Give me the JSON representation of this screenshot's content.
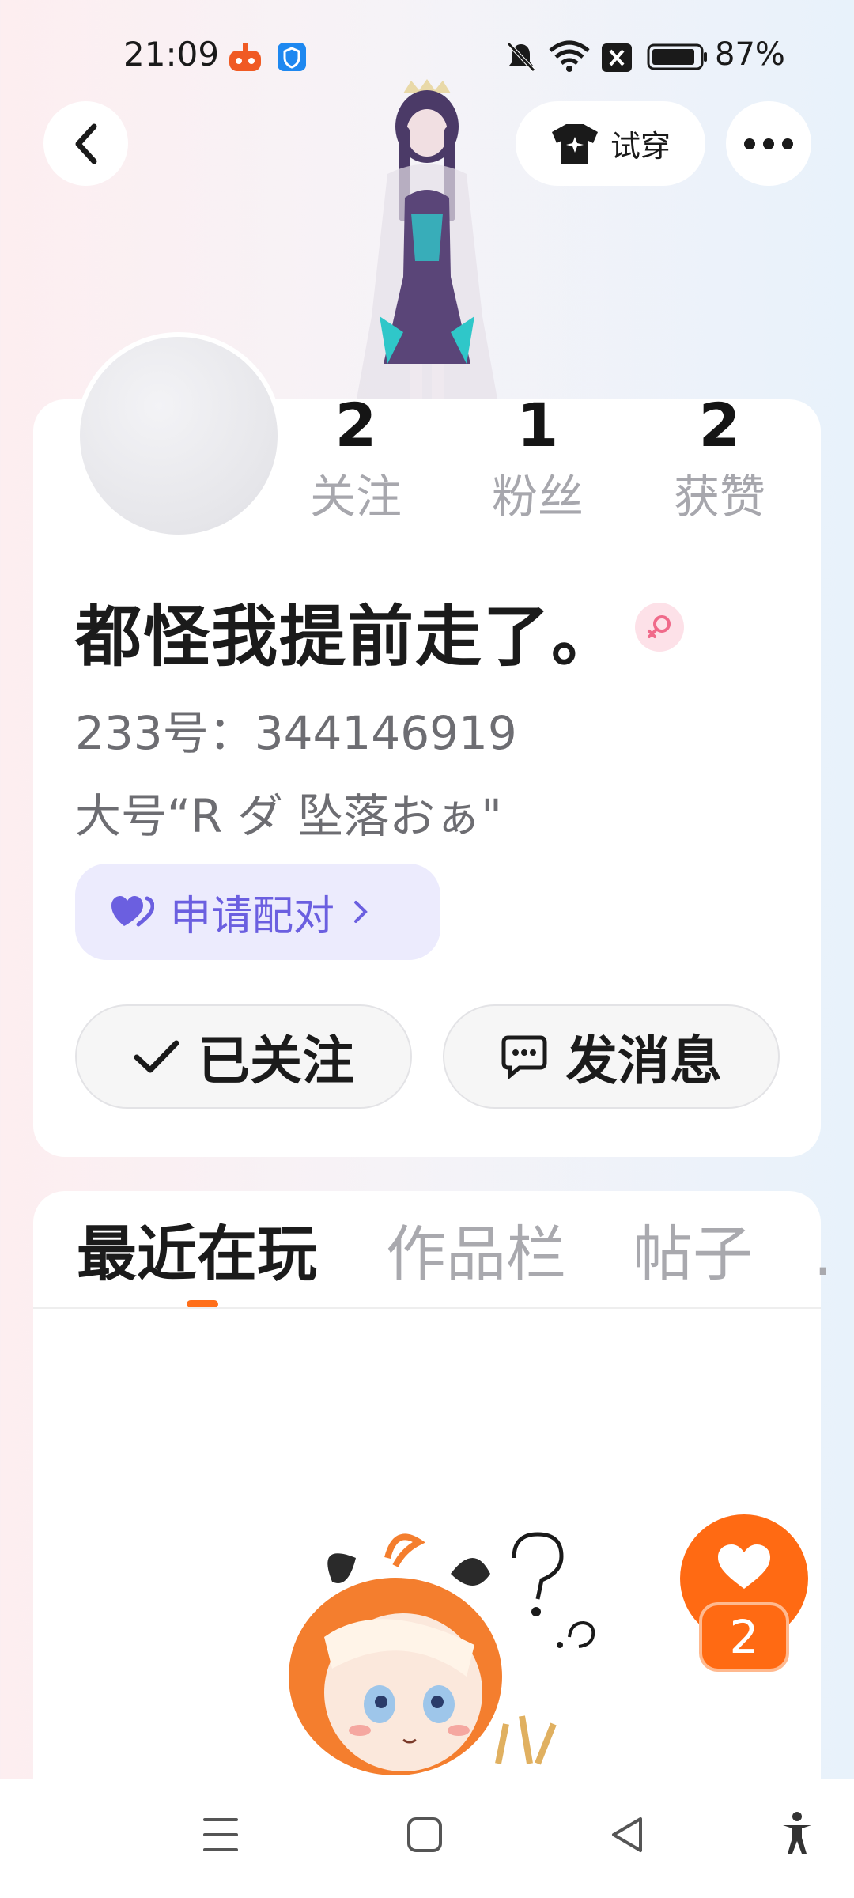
{
  "status_bar": {
    "time": "21:09",
    "battery": "87%"
  },
  "top_bar": {
    "try_on_label": "试穿"
  },
  "profile": {
    "stats": [
      {
        "value": "2",
        "label": "关注"
      },
      {
        "value": "1",
        "label": "粉丝"
      },
      {
        "value": "2",
        "label": "获赞"
      }
    ],
    "name": "都怪我提前走了。",
    "uid": "233号：344146919",
    "bio": "大号“R ダ  坠落おぁ\"",
    "pair_label": "申请配对",
    "follow_label": "已关注",
    "message_label": "发消息"
  },
  "tabs": [
    {
      "label": "最近在玩",
      "active": true
    },
    {
      "label": "作品栏",
      "active": false
    },
    {
      "label": "帖子",
      "active": false
    },
    {
      "label": "…",
      "active": false
    }
  ],
  "like_count": "2",
  "colors": {
    "accent": "#ff6a13",
    "pair": "#6b5fe0",
    "gender": "#f06a8a"
  }
}
